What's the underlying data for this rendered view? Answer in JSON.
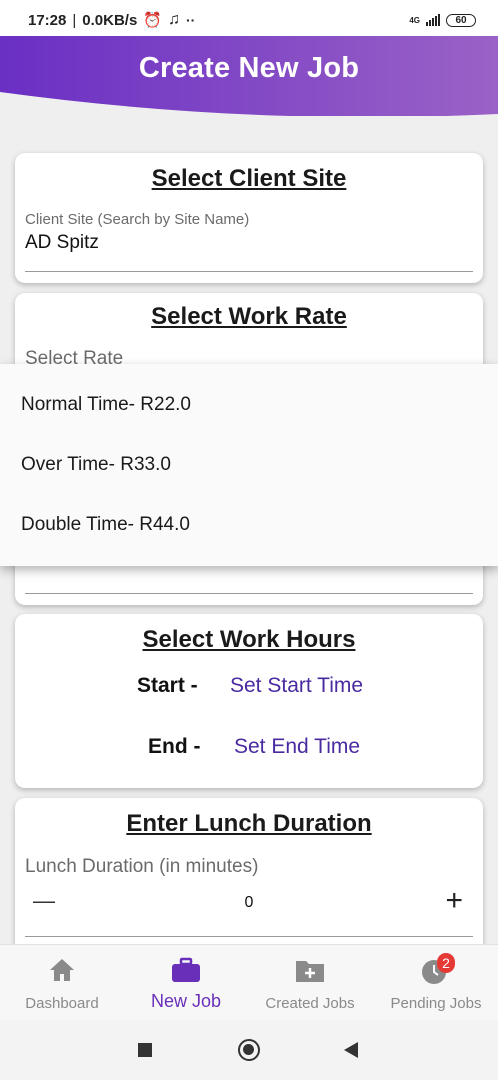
{
  "status_bar": {
    "time": "17:28",
    "speed": "0.0KB/s",
    "network": "4G",
    "battery": "60"
  },
  "header": {
    "title": "Create New Job"
  },
  "client_site": {
    "title": "Select Client Site",
    "label": "Client Site (Search by Site Name)",
    "value": "AD Spitz"
  },
  "work_rate": {
    "title": "Select Work Rate",
    "label": "Select Rate",
    "options": [
      "Normal Time- R22.0",
      "Over Time- R33.0",
      "Double Time- R44.0"
    ]
  },
  "work_hours": {
    "title": "Select Work Hours",
    "start_label": "Start -",
    "start_value": "Set Start Time",
    "end_label": "End -",
    "end_value": "Set End Time"
  },
  "lunch": {
    "title": "Enter Lunch Duration",
    "label": "Lunch Duration (in minutes)",
    "value": "0",
    "minus": "—",
    "plus": "+"
  },
  "bottom_nav": {
    "items": [
      {
        "label": "Dashboard",
        "icon": "home-icon"
      },
      {
        "label": "New Job",
        "icon": "briefcase-icon"
      },
      {
        "label": "Created Jobs",
        "icon": "folder-plus-icon"
      },
      {
        "label": "Pending Jobs",
        "icon": "pending-icon",
        "badge": "2"
      }
    ]
  },
  "colors": {
    "header_start": "#6a2fc4",
    "header_end": "#9a62c6",
    "accent": "#6a2fb8",
    "link": "#4a2aa0",
    "badge": "#e53935"
  }
}
